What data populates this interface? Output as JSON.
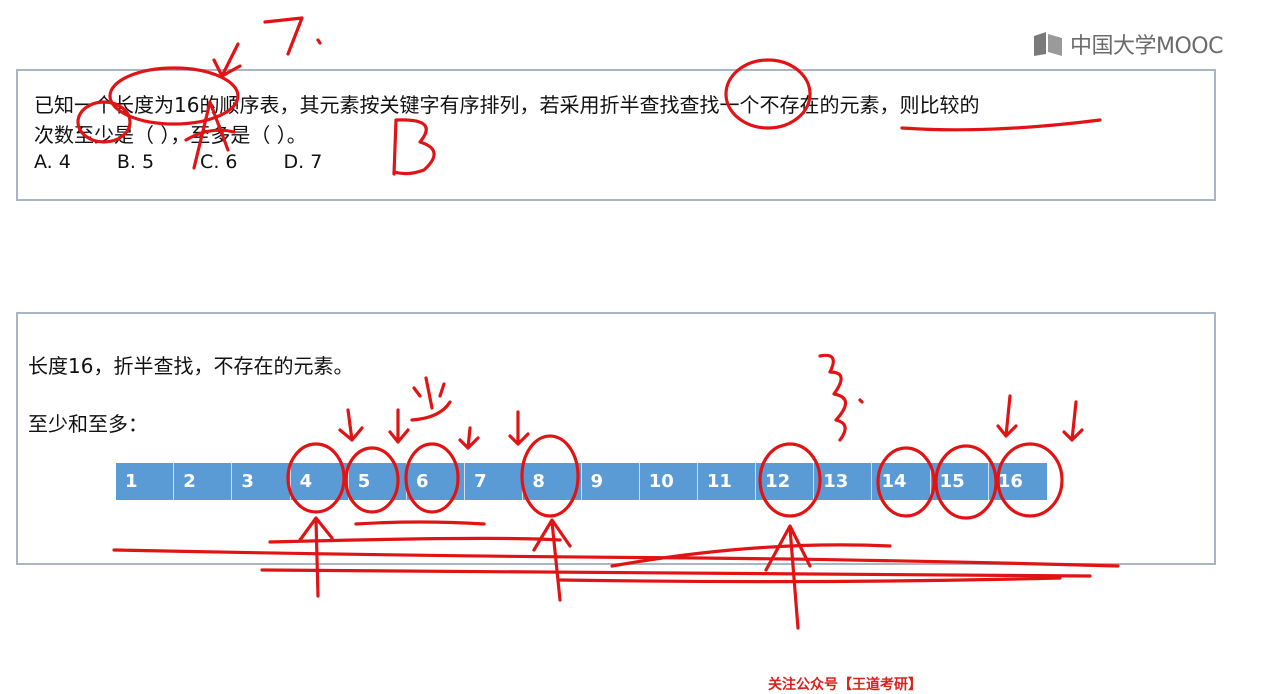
{
  "logo": {
    "text": "中国大学MOOC"
  },
  "question": {
    "line1": "已知一个长度为16的顺序表，其元素按关键字有序排列，若采用折半查找查找一个不存在的元素，则比较的",
    "line2": "次数至少是（    ），至多是（    ）。",
    "options": [
      "A. 4",
      "B. 5",
      "C. 6",
      "D. 7"
    ]
  },
  "answer": {
    "line1": "长度16，折半查找，不存在的元素。",
    "line2": "至少和至多：",
    "cells": [
      "1",
      "2",
      "3",
      "4",
      "5",
      "6",
      "7",
      "8",
      "9",
      "10",
      "11",
      "12",
      "13",
      "14",
      "15",
      "16"
    ]
  },
  "footer": {
    "text": "关注公众号【王道考研】"
  },
  "colors": {
    "ink": "#e01414",
    "cell": "#5b9bd5",
    "border": "#a9b4c4"
  }
}
